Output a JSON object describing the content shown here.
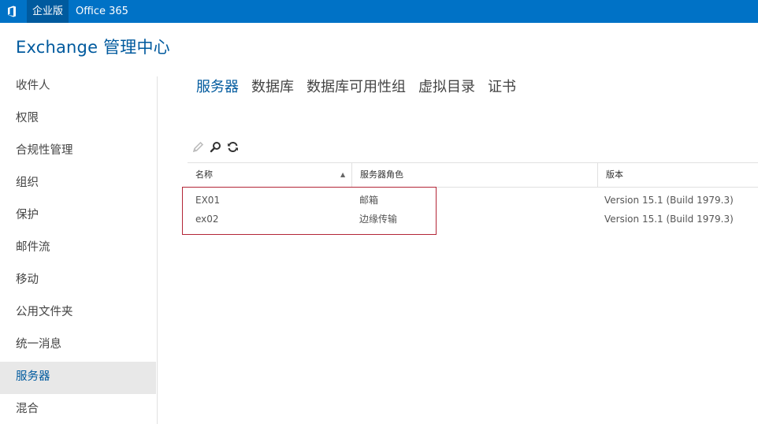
{
  "topbar": {
    "logo_icon": "office-logo-icon",
    "edition_tab": "企业版",
    "product": "Office 365",
    "background_color": "#0072c6"
  },
  "app_title": "Exchange 管理中心",
  "sidebar": {
    "items": [
      {
        "label": "收件人"
      },
      {
        "label": "权限"
      },
      {
        "label": "合规性管理"
      },
      {
        "label": "组织"
      },
      {
        "label": "保护"
      },
      {
        "label": "邮件流"
      },
      {
        "label": "移动"
      },
      {
        "label": "公用文件夹"
      },
      {
        "label": "统一消息"
      },
      {
        "label": "服务器",
        "selected": true
      },
      {
        "label": "混合"
      }
    ]
  },
  "tabs": [
    {
      "label": "服务器",
      "active": true
    },
    {
      "label": "数据库"
    },
    {
      "label": "数据库可用性组"
    },
    {
      "label": "虚拟目录"
    },
    {
      "label": "证书"
    }
  ],
  "toolbar": {
    "icons": [
      "pencil-edit-icon",
      "search-icon",
      "refresh-icon"
    ]
  },
  "grid": {
    "columns": [
      "名称",
      "服务器角色",
      "版本"
    ],
    "sort_column": "名称",
    "sort_direction": "ascending",
    "rows": [
      {
        "name": "EX01",
        "role": "邮箱",
        "version": "Version 15.1 (Build 1979.3)"
      },
      {
        "name": "ex02",
        "role": "边缘传输",
        "version": "Version 15.1 (Build 1979.3)"
      }
    ]
  },
  "colors": {
    "accent": "#005a9e",
    "highlight_box": "#b32637"
  }
}
